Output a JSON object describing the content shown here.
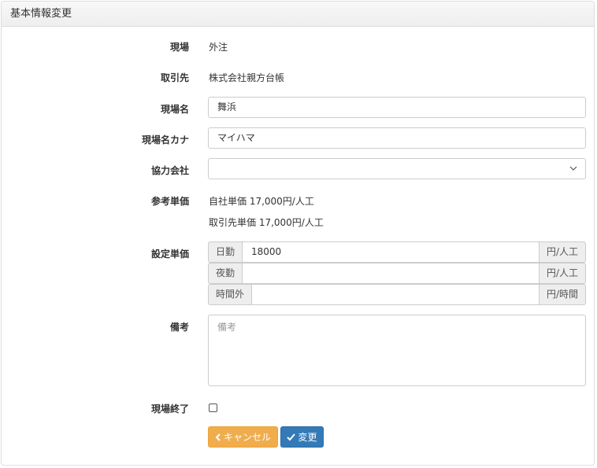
{
  "panel": {
    "title": "基本情報変更"
  },
  "form": {
    "site": {
      "label": "現場",
      "value": "外注"
    },
    "client": {
      "label": "取引先",
      "value": "株式会社親方台帳"
    },
    "site_name": {
      "label": "現場名",
      "value": "舞浜"
    },
    "site_name_kana": {
      "label": "現場名カナ",
      "value": "マイハマ"
    },
    "partner_company": {
      "label": "協力会社",
      "value": "",
      "icon": "chevron-down-icon"
    },
    "reference_price": {
      "label": "参考単価",
      "own_price": "自社単価 17,000円/人工",
      "client_price": "取引先単価 17,000円/人工"
    },
    "set_price": {
      "label": "設定単価",
      "rows": [
        {
          "prefix": "日勤",
          "value": "18000",
          "suffix": "円/人工"
        },
        {
          "prefix": "夜勤",
          "value": "",
          "suffix": "円/人工"
        },
        {
          "prefix": "時間外",
          "value": "",
          "suffix": "円/時間"
        }
      ]
    },
    "remarks": {
      "label": "備考",
      "placeholder": "備考"
    },
    "site_closed": {
      "label": "現場終了",
      "checked": false
    }
  },
  "buttons": {
    "cancel": {
      "label": "キャンセル",
      "icon": "chevron-left-icon",
      "color": "#f0ad4e"
    },
    "submit": {
      "label": "変更",
      "icon": "check-icon",
      "color": "#337ab7"
    }
  }
}
